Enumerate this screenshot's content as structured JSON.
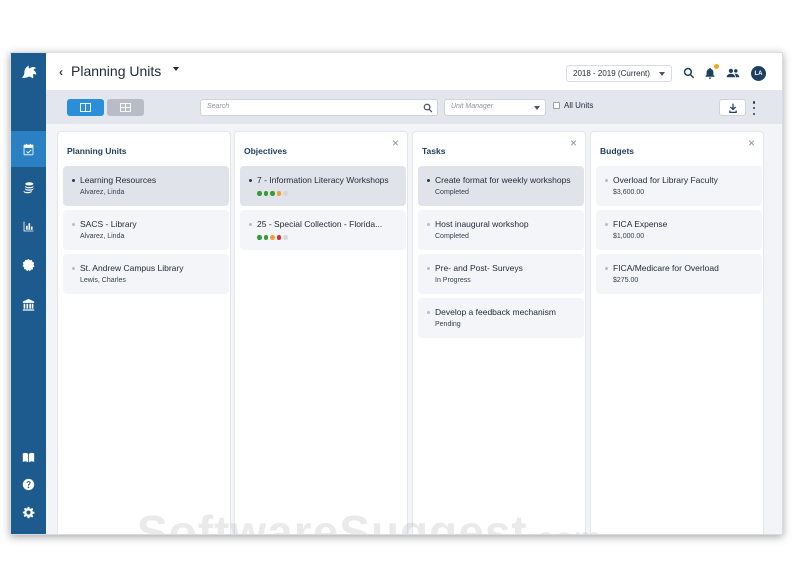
{
  "header": {
    "title": "Planning Units",
    "year": "2018 - 2019 (Current)",
    "avatar": "LA"
  },
  "toolbar": {
    "search_placeholder": "Search",
    "unit_manager_placeholder": "Unit Manager",
    "all_units_label": "All Units"
  },
  "columns": {
    "planning_units": {
      "title": "Planning Units",
      "items": [
        {
          "title": "Learning Resources",
          "sub": "Alvarez, Linda"
        },
        {
          "title": "SACS - Library",
          "sub": "Alvarez, Linda"
        },
        {
          "title": "St. Andrew Campus Library",
          "sub": "Lewis, Charles"
        }
      ]
    },
    "objectives": {
      "title": "Objectives",
      "items": [
        {
          "title": "7 - Information Literacy Workshops",
          "dots": [
            "#3a9a3a",
            "#3a9a3a",
            "#3a9a3a",
            "#f0a030",
            "#d8d8dc"
          ]
        },
        {
          "title": "25 - Special Collection - Florida...",
          "dots": [
            "#3a9a3a",
            "#3a9a3a",
            "#f0a030",
            "#d23030",
            "#d8d8dc"
          ]
        }
      ]
    },
    "tasks": {
      "title": "Tasks",
      "items": [
        {
          "title": "Create format for weekly workshops",
          "sub": "Completed"
        },
        {
          "title": "Host inaugural workshop",
          "sub": "Completed"
        },
        {
          "title": "Pre- and Post- Surveys",
          "sub": "In Progress"
        },
        {
          "title": "Develop a feedback mechanism",
          "sub": "Pending"
        }
      ]
    },
    "budgets": {
      "title": "Budgets",
      "items": [
        {
          "title": "Overload for Library Faculty",
          "sub": "$3,600.00"
        },
        {
          "title": "FICA Expense",
          "sub": "$1,000.00"
        },
        {
          "title": "FICA/Medicare for Overload",
          "sub": "$275.00"
        }
      ]
    }
  },
  "watermark": {
    "main": "SoftwareSuggest",
    "suffix": ".com"
  },
  "icons": {
    "sidebar": [
      "calendar-check-icon",
      "coins-icon",
      "bar-chart-icon",
      "badge-icon",
      "bank-icon",
      "book-icon",
      "help-icon",
      "gear-icon"
    ],
    "header": [
      "search-icon",
      "bell-icon",
      "users-icon"
    ]
  },
  "colors": {
    "sidebar": "#1d5a8e",
    "sidebar_active": "#2a80c2",
    "accent": "#2a8fd8",
    "heading": "#1d3f62"
  }
}
